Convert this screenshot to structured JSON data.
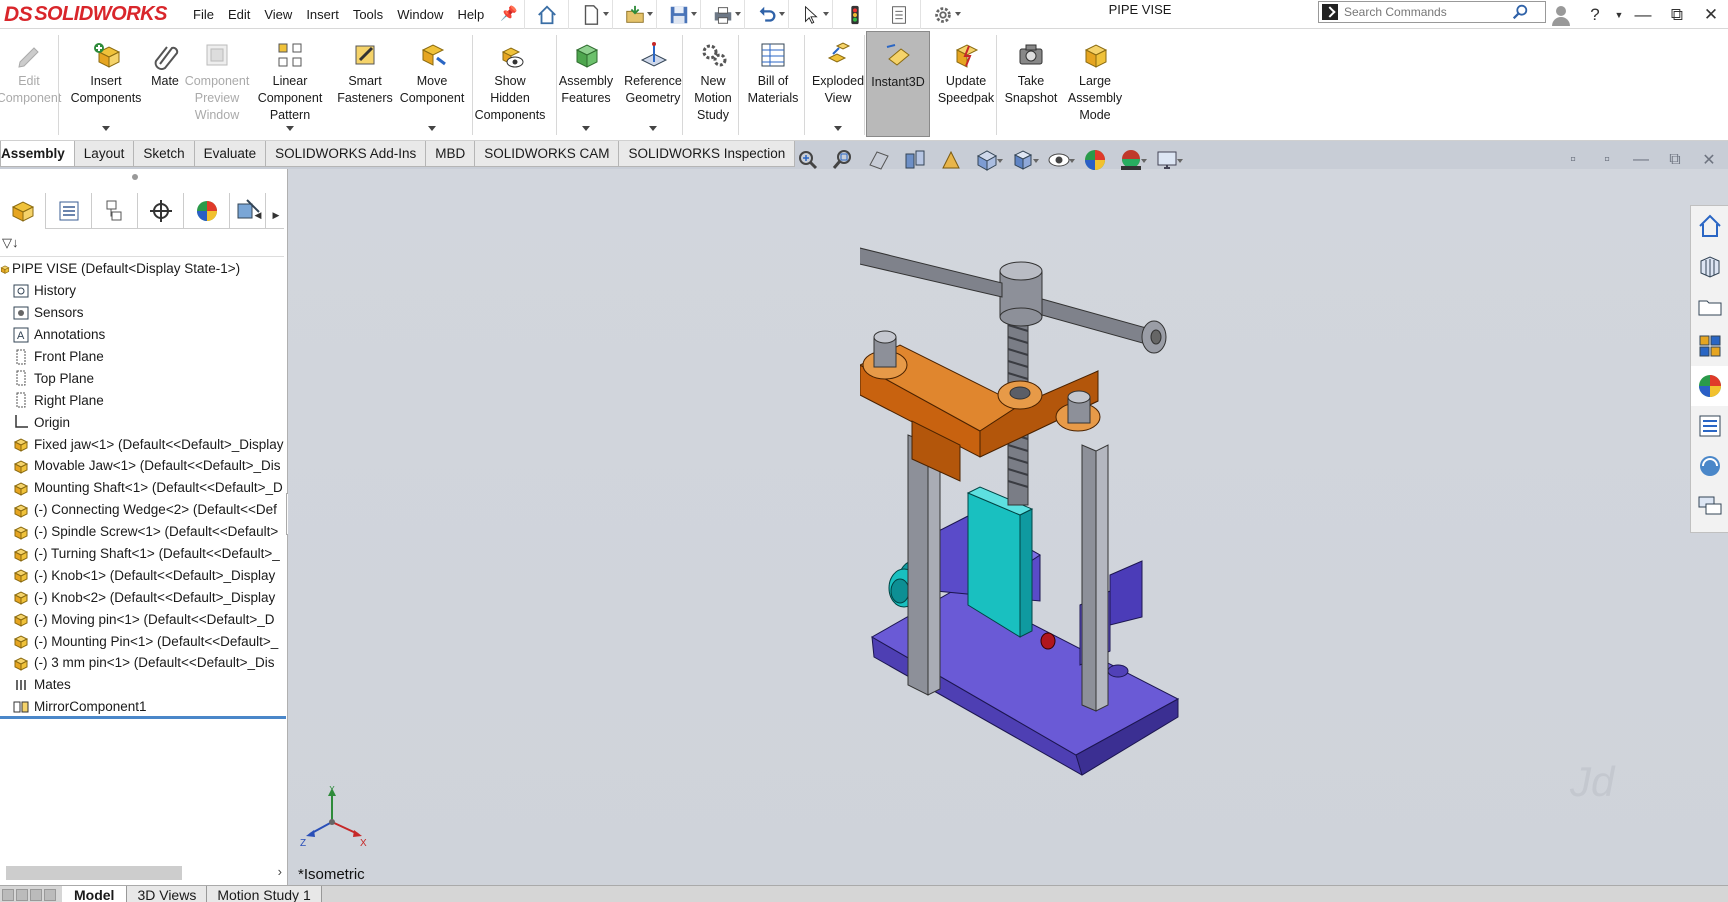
{
  "app": {
    "brand": "SOLIDWORKS",
    "brand_prefix": "DS",
    "document_title": "PIPE VISE"
  },
  "menu": [
    "File",
    "Edit",
    "View",
    "Insert",
    "Tools",
    "Window",
    "Help"
  ],
  "quick_access": [
    {
      "icon": "home-icon"
    },
    {
      "icon": "new-document-icon"
    },
    {
      "icon": "open-icon"
    },
    {
      "icon": "save-icon"
    },
    {
      "icon": "print-icon"
    },
    {
      "icon": "undo-icon"
    },
    {
      "icon": "select-cursor-icon"
    },
    {
      "icon": "rebuild-traffic-light-icon"
    },
    {
      "icon": "file-properties-icon"
    },
    {
      "icon": "options-gear-icon"
    }
  ],
  "search": {
    "placeholder": "Search Commands"
  },
  "commands": [
    {
      "label": "Edit\nComponent",
      "icon": "edit-component-icon",
      "disabled": true,
      "dropdown": false
    },
    {
      "label": "Insert\nComponents",
      "icon": "insert-components-icon",
      "disabled": false,
      "dropdown": true
    },
    {
      "label": "Mate",
      "icon": "mate-paperclip-icon",
      "disabled": false,
      "dropdown": false
    },
    {
      "label": "Component\nPreview\nWindow",
      "icon": "component-preview-icon",
      "disabled": true,
      "dropdown": false
    },
    {
      "label": "Linear\nComponent\nPattern",
      "icon": "linear-pattern-icon",
      "disabled": false,
      "dropdown": true
    },
    {
      "label": "Smart\nFasteners",
      "icon": "smart-fasteners-icon",
      "disabled": false,
      "dropdown": false
    },
    {
      "label": "Move\nComponent",
      "icon": "move-component-icon",
      "disabled": false,
      "dropdown": true
    },
    {
      "label": "Show\nHidden\nComponents",
      "icon": "show-hidden-icon",
      "disabled": false,
      "dropdown": false
    },
    {
      "label": "Assembly\nFeatures",
      "icon": "assembly-features-icon",
      "disabled": false,
      "dropdown": true
    },
    {
      "label": "Reference\nGeometry",
      "icon": "reference-geometry-icon",
      "disabled": false,
      "dropdown": true
    },
    {
      "label": "New\nMotion\nStudy",
      "icon": "motion-study-icon",
      "disabled": false,
      "dropdown": false
    },
    {
      "label": "Bill of\nMaterials",
      "icon": "bill-of-materials-icon",
      "disabled": false,
      "dropdown": false
    },
    {
      "label": "Exploded\nView",
      "icon": "exploded-view-icon",
      "disabled": false,
      "dropdown": true
    },
    {
      "label": "Instant3D",
      "icon": "instant3d-icon",
      "disabled": false,
      "dropdown": false,
      "active": true
    },
    {
      "label": "Update\nSpeedpak",
      "icon": "speedpak-icon",
      "disabled": false,
      "dropdown": false
    },
    {
      "label": "Take\nSnapshot",
      "icon": "camera-icon",
      "disabled": false,
      "dropdown": false
    },
    {
      "label": "Large\nAssembly\nMode",
      "icon": "large-assembly-icon",
      "disabled": false,
      "dropdown": false
    }
  ],
  "tabs": [
    {
      "label": "Assembly",
      "selected": true
    },
    {
      "label": "Layout"
    },
    {
      "label": "Sketch"
    },
    {
      "label": "Evaluate"
    },
    {
      "label": "SOLIDWORKS Add-Ins"
    },
    {
      "label": "MBD"
    },
    {
      "label": "SOLIDWORKS CAM"
    },
    {
      "label": "SOLIDWORKS Inspection"
    }
  ],
  "feature_tree": {
    "root": "PIPE VISE  (Default<Display State-1>)",
    "items": [
      {
        "label": "History",
        "icon": "history-icon"
      },
      {
        "label": "Sensors",
        "icon": "sensors-icon"
      },
      {
        "label": "Annotations",
        "icon": "annotations-icon"
      },
      {
        "label": "Front Plane",
        "icon": "plane-icon"
      },
      {
        "label": "Top Plane",
        "icon": "plane-icon"
      },
      {
        "label": "Right Plane",
        "icon": "plane-icon"
      },
      {
        "label": "Origin",
        "icon": "origin-icon"
      },
      {
        "label": "Fixed jaw<1> (Default<<Default>_Display",
        "icon": "part-icon"
      },
      {
        "label": "Movable Jaw<1> (Default<<Default>_Dis",
        "icon": "part-icon"
      },
      {
        "label": "Mounting Shaft<1> (Default<<Default>_D",
        "icon": "part-icon"
      },
      {
        "label": "(-) Connecting Wedge<2> (Default<<Def",
        "icon": "part-icon"
      },
      {
        "label": "(-) Spindle Screw<1> (Default<<Default>",
        "icon": "part-icon"
      },
      {
        "label": "(-) Turning Shaft<1> (Default<<Default>_",
        "icon": "part-icon"
      },
      {
        "label": "(-) Knob<1> (Default<<Default>_Display",
        "icon": "part-icon"
      },
      {
        "label": "(-) Knob<2> (Default<<Default>_Display",
        "icon": "part-icon"
      },
      {
        "label": "(-) Moving pin<1> (Default<<Default>_D",
        "icon": "part-icon"
      },
      {
        "label": "(-) Mounting Pin<1> (Default<<Default>_",
        "icon": "part-icon"
      },
      {
        "label": "(-) 3 mm pin<1> (Default<<Default>_Dis",
        "icon": "part-icon"
      },
      {
        "label": "Mates",
        "icon": "mates-icon"
      },
      {
        "label": "MirrorComponent1",
        "icon": "mirror-component-icon"
      }
    ]
  },
  "graphics": {
    "view_label": "*Isometric",
    "watermark": "Jd"
  },
  "bottom_tabs": [
    {
      "label": "Model",
      "selected": true
    },
    {
      "label": "3D Views"
    },
    {
      "label": "Motion Study 1"
    }
  ],
  "colors": {
    "brand_red": "#d9262b",
    "fixed_jaw": "#6a5ad6",
    "movable_jaw": "#19c0c0",
    "yoke": "#c8620f",
    "shaft_gray": "#9a9da6"
  }
}
